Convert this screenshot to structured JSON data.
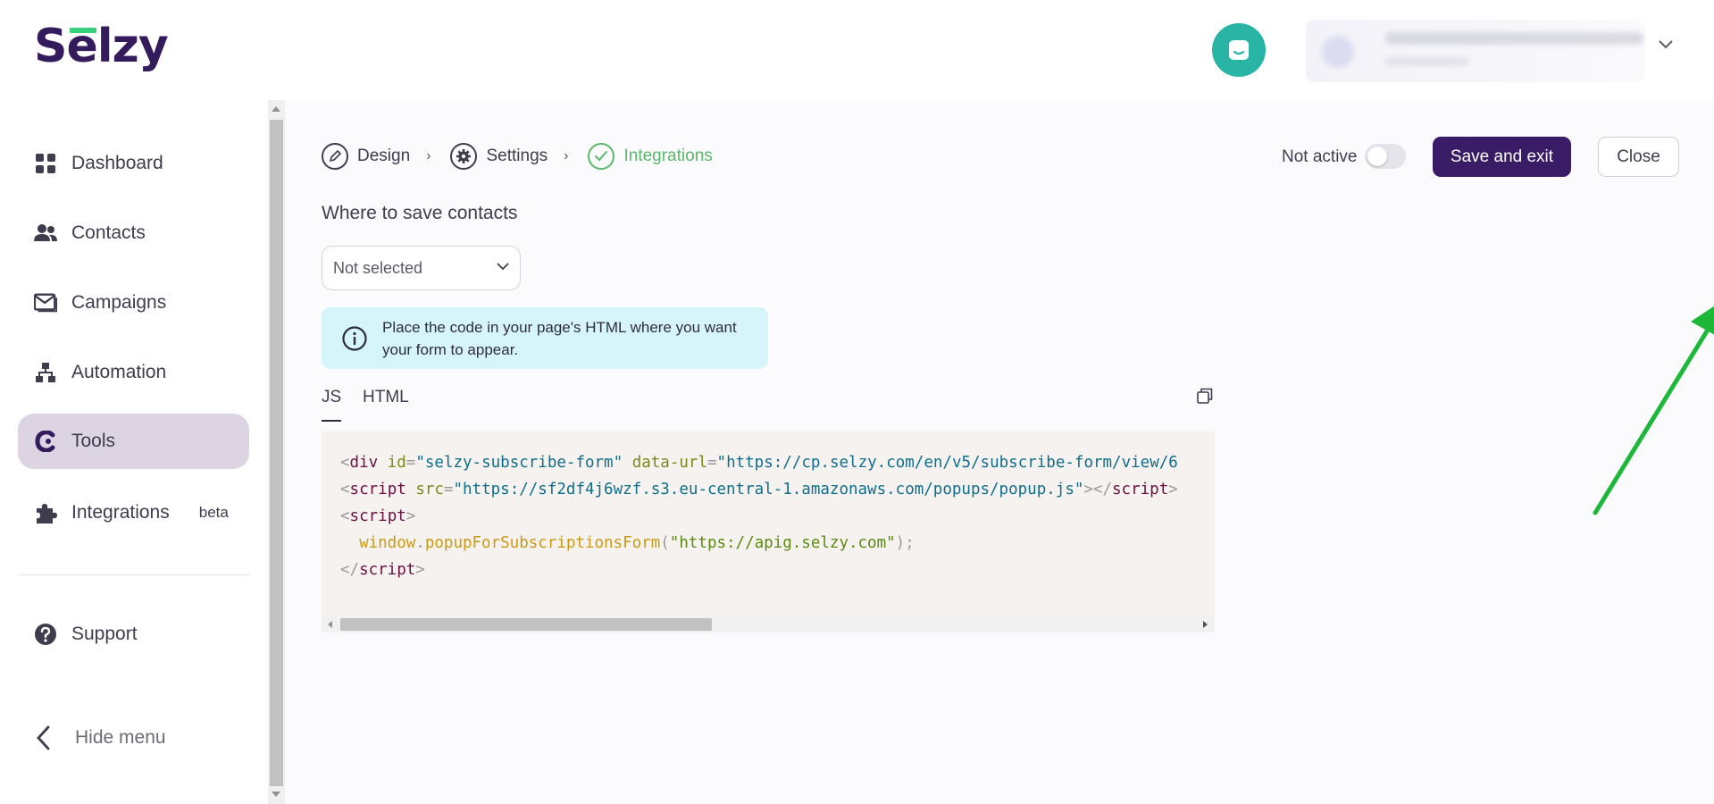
{
  "header": {
    "logo": "Selzy",
    "chat_icon": "chat-bubble-icon",
    "account_icon": "chevron-down-icon"
  },
  "sidebar": {
    "items": [
      {
        "label": "Dashboard",
        "icon": "dashboard-grid-icon"
      },
      {
        "label": "Contacts",
        "icon": "users-icon"
      },
      {
        "label": "Campaigns",
        "icon": "envelope-icon"
      },
      {
        "label": "Automation",
        "icon": "hierarchy-icon"
      },
      {
        "label": "Tools",
        "icon": "tools-icon",
        "active": true
      },
      {
        "label": "Integrations",
        "icon": "puzzle-icon",
        "badge": "beta"
      }
    ],
    "support": {
      "label": "Support",
      "icon": "question-circle-icon"
    },
    "hide_menu": {
      "label": "Hide menu",
      "icon": "chevron-left-icon"
    }
  },
  "steps": [
    {
      "label": "Design",
      "icon": "pencil-icon"
    },
    {
      "label": "Settings",
      "icon": "gear-icon"
    },
    {
      "label": "Integrations",
      "icon": "check-icon",
      "done": true
    }
  ],
  "toolbar": {
    "status_label": "Not active",
    "save_label": "Save and exit",
    "close_label": "Close"
  },
  "contacts": {
    "title": "Where to save contacts",
    "select_value": "Not selected"
  },
  "info": {
    "text": "Place the code in your page's HTML where you want your form to appear."
  },
  "code_tabs": [
    {
      "label": "JS",
      "active": true
    },
    {
      "label": "HTML"
    }
  ],
  "code": {
    "line1": {
      "div_id": "selzy-subscribe-form",
      "data_url": "https://cp.selzy.com/en/v5/subscribe-form/view/6"
    },
    "line2": {
      "src": "https://sf2df4j6wzf.s3.eu-central-1.amazonaws.com/popups/popup.js"
    },
    "line4": {
      "fn_object": "window",
      "fn_name": "popupForSubscriptionsForm",
      "arg": "\"https://apig.selzy.com\""
    }
  },
  "colors": {
    "brand": "#341c5c",
    "accent_green": "#36d17a",
    "active_nav": "#dcd3e3",
    "save_button": "#3a1c66",
    "info_bg": "#d6f5fb",
    "arrow": "#1db83a"
  }
}
